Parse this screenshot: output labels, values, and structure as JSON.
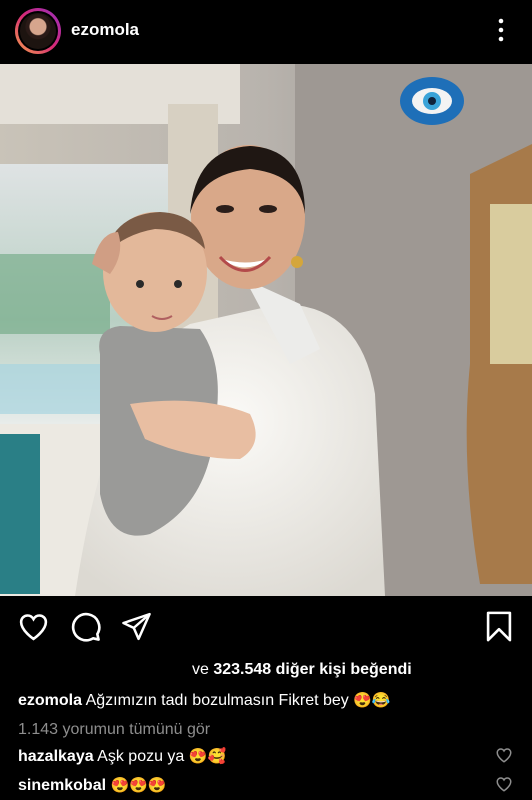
{
  "post": {
    "username": "ezomola",
    "likes_prefix": "ve",
    "likes_count": "323.548",
    "likes_suffix": "diğer kişi beğendi",
    "caption_user": "ezomola",
    "caption_text": "Ağzımızın tadı bozulmasın Fikret bey",
    "caption_emojis": "😍😂",
    "view_all_comments": "1.143 yorumun tümünü gör"
  },
  "comments": [
    {
      "user": "hazalkaya",
      "text": "Aşk pozu ya",
      "emojis": "😍🥰"
    },
    {
      "user": "sinemkobal",
      "text": "",
      "emojis": "😍😍😍"
    }
  ],
  "icons": {
    "more": "more-vertical-icon",
    "like": "heart-icon",
    "comment": "comment-icon",
    "share": "send-icon",
    "save": "bookmark-icon"
  },
  "colors": {
    "background": "#000000",
    "text": "#ffffff",
    "muted": "#8e8e8e"
  }
}
